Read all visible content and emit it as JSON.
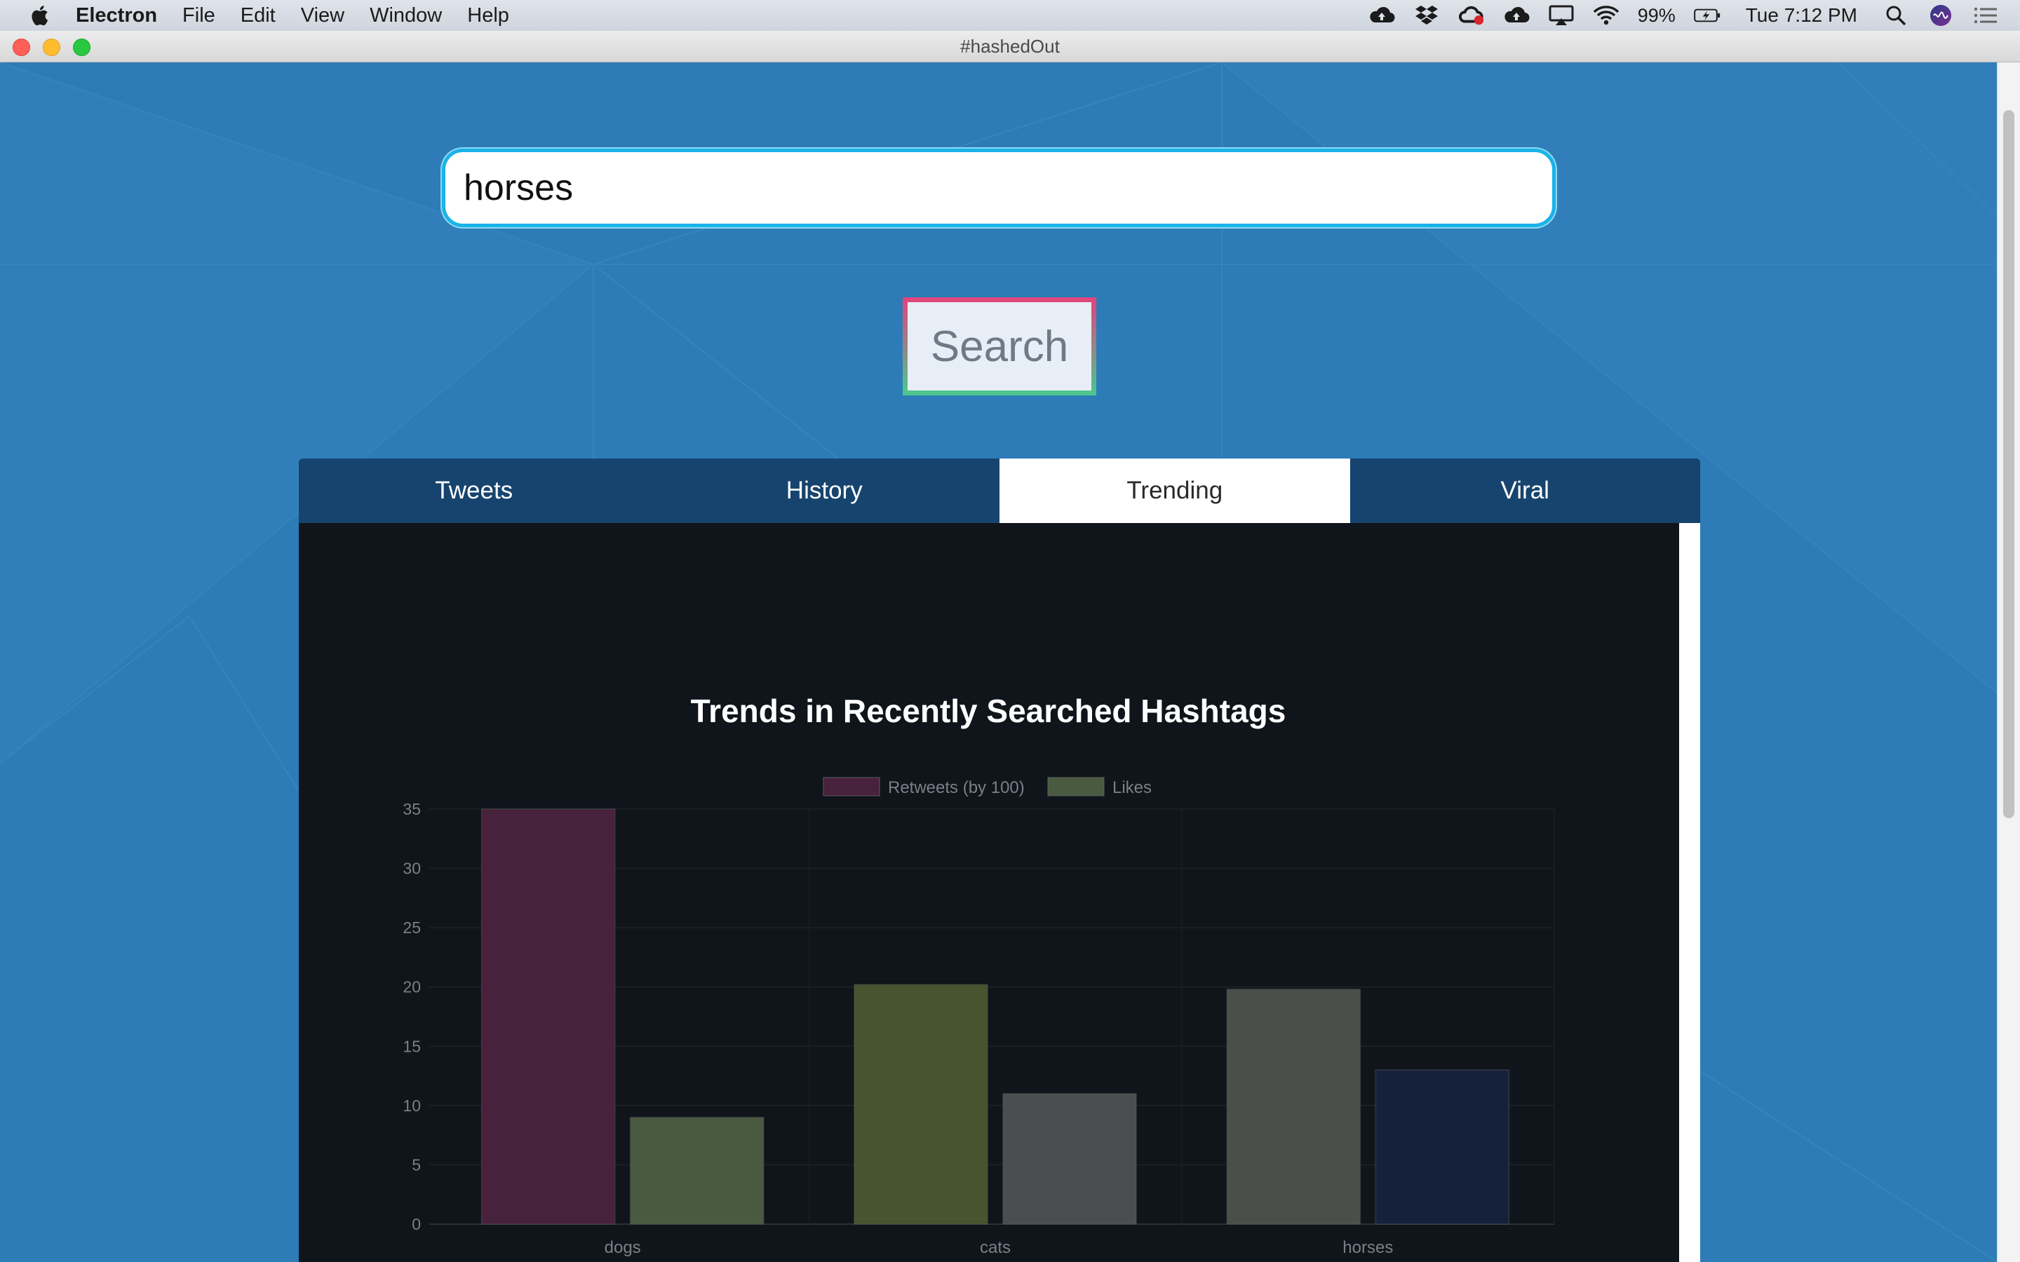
{
  "menubar": {
    "app_name": "Electron",
    "menus": [
      "File",
      "Edit",
      "View",
      "Window",
      "Help"
    ],
    "battery": "99%",
    "clock": "Tue 7:12 PM"
  },
  "window": {
    "title": "#hashedOut"
  },
  "search": {
    "value": "horses",
    "button_label": "Search"
  },
  "tabs": [
    {
      "label": "Tweets",
      "active": false
    },
    {
      "label": "History",
      "active": false
    },
    {
      "label": "Trending",
      "active": true
    },
    {
      "label": "Viral",
      "active": false
    }
  ],
  "colors": {
    "accent": "#1ab3e8",
    "tab_bar": "#16446e",
    "chart_background": "#0f151b"
  },
  "chart_data": {
    "type": "bar",
    "title": "Trends in Recently Searched Hashtags",
    "categories": [
      "dogs",
      "cats",
      "horses"
    ],
    "series": [
      {
        "name": "Retweets (by 100)",
        "values": [
          35,
          20.2,
          19.8
        ],
        "colors": [
          "#48213c",
          "#48532f",
          "#4a4f49"
        ]
      },
      {
        "name": "Likes",
        "values": [
          9,
          11,
          13
        ],
        "colors": [
          "#4a5a40",
          "#4a4e51",
          "#15203a"
        ]
      }
    ],
    "legend_colors": [
      "#48213c",
      "#4a5a40"
    ],
    "ylim": [
      0,
      35
    ],
    "yticks": [
      0,
      5,
      10,
      15,
      20,
      25,
      30,
      35
    ],
    "grid": true,
    "legend": "top"
  }
}
